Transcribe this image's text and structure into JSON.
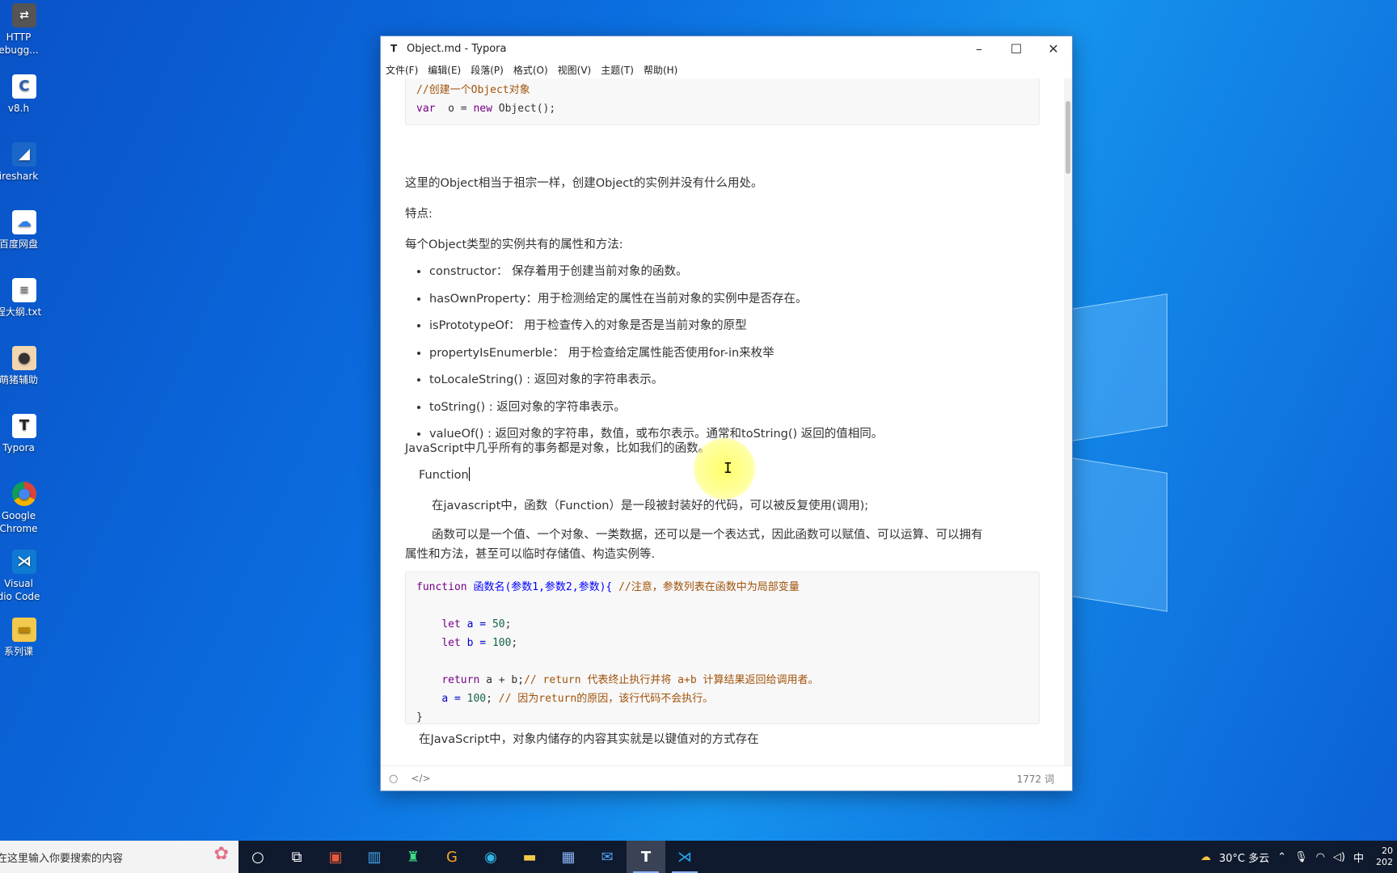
{
  "desktop": {
    "icons": [
      {
        "label": "HTTP\nebugg..."
      },
      {
        "label": "v8.h"
      },
      {
        "label": "ireshark"
      },
      {
        "label": "百度网盘"
      },
      {
        "label": "程大纲.txt"
      },
      {
        "label": "萌猪辅助"
      },
      {
        "label": "Typora"
      },
      {
        "label": "Google\nChrome"
      },
      {
        "label": "Visual\ndio Code"
      },
      {
        "label": "系列课"
      }
    ]
  },
  "window": {
    "title": "Object.md - Typora",
    "menu": [
      "文件(F)",
      "编辑(E)",
      "段落(P)",
      "格式(O)",
      "视图(V)",
      "主题(T)",
      "帮助(H)"
    ],
    "word_count": "1772 词"
  },
  "doc": {
    "code1": {
      "line1": "//创建一个Object对象",
      "kw_var": "var",
      "mid": "  o = ",
      "kw_new": "new",
      "rest": " Object();"
    },
    "p1": "这里的Object相当于祖宗一样，创建Object的实例并没有什么用处。",
    "p2": "特点:",
    "p3": "每个Object类型的实例共有的属性和方法:",
    "bullets": [
      "constructor：  保存着用于创建当前对象的函数。",
      "hasOwnProperty：用于检测给定的属性在当前对象的实例中是否存在。",
      "isPrototypeOf：  用于检查传入的对象是否是当前对象的原型",
      "propertyIsEnumerble：  用于检查给定属性能否使用for-in来枚举",
      "toLocaleString() : 返回对象的字符串表示。",
      "toString() : 返回对象的字符串表示。",
      "valueOf() : 返回对象的字符串，数值，或布尔表示。通常和toString() 返回的值相同。"
    ],
    "p4": "JavaScript中几乎所有的事务都是对象，比如我们的函数。",
    "p5": "Function",
    "p6": "在javascript中，函数（Function）是一段被封装好的代码，可以被反复使用(调用);",
    "p7a": "函数可以是一个值、一个对象、一类数据，还可以是一个表达式，因此函数可以赋值、可以运算、可以拥有",
    "p7b": "属性和方法，甚至可以临时存储值、构造实例等.",
    "code2": {
      "kw_function": "function",
      "sig": " 函数名(参数1,参数2,参数){ ",
      "sig_comment": "//注意，参数列表在函数中为局部变量",
      "kw_let": "let",
      "a_decl": " a = ",
      "a_val": "50",
      "b_decl": " b = ",
      "b_val": "100",
      "semi": ";",
      "kw_return": "return",
      "ret_expr": " a + b;",
      "ret_comment": "// return 代表终止执行并将 a+b 计算结果返回给调用者。",
      "assign": "a = ",
      "assign_val": "100",
      "assign_semi": "; ",
      "assign_comment": "// 因为return的原因，该行代码不会执行。",
      "close": "}"
    },
    "p8": "在JavaScript中，对象内储存的内容其实就是以键值对的方式存在"
  },
  "taskbar": {
    "search_placeholder": "在这里输入你要搜索的内容",
    "weather": "30°C  多云",
    "ime": "中",
    "clock_top": "20",
    "clock_bottom": "202"
  }
}
